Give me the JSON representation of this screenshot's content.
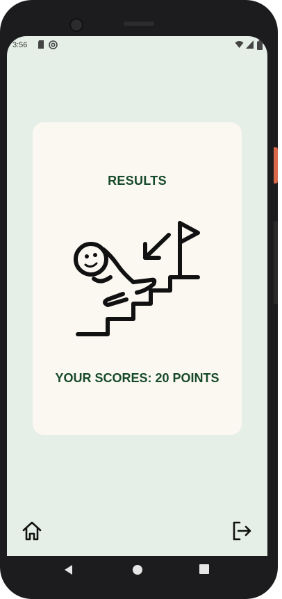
{
  "status_bar": {
    "time": "3:56",
    "left_icons": [
      "sd-card-icon",
      "at-sign-icon"
    ],
    "right_icons": [
      "wifi-icon",
      "signal-icon",
      "battery-icon"
    ]
  },
  "card": {
    "title": "RESULTS",
    "illustration_icon": "person-falling-down-stairs-icon",
    "score_text": "YOUR SCORES: 20 POINTS"
  },
  "bottom_actions": {
    "home_icon": "home-icon",
    "exit_icon": "logout-icon"
  },
  "nav_bar": [
    "back-icon",
    "home-circle-icon",
    "recents-icon"
  ],
  "colors": {
    "screen_background": "#e5efe7",
    "card_background": "#fbf8f2",
    "title_text": "#174a2a",
    "device_frame": "#1c1c1e"
  }
}
